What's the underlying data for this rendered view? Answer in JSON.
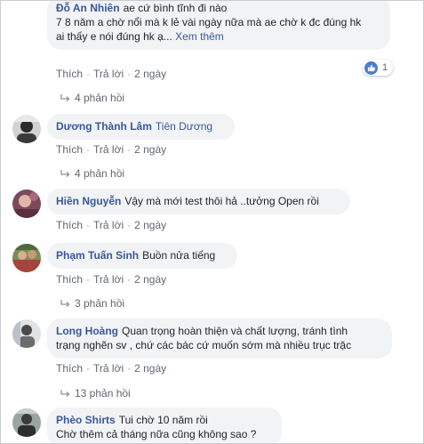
{
  "comments": [
    {
      "author": "Đỗ An Nhiên",
      "mention": "",
      "text_lines": [
        "ae cứ bình tĩnh đi nào",
        "7 8 năm a chờ nổi mà k lẻ vài ngày nữa mà ae chờ k đc đúng hk",
        "ai thấy e nói đúng hk ạ..."
      ],
      "see_more": "Xem thêm",
      "like": "Thích",
      "reply": "Trả lời",
      "time": "2 ngày",
      "reaction_count": "1",
      "reaction_icon": "like-icon",
      "replies": "4 phản hồi"
    },
    {
      "author": "Dương Thành Lâm",
      "mention": "Tiên Dương",
      "text": "",
      "like": "Thích",
      "reply": "Trả lời",
      "time": "2 ngày",
      "replies": "4 phản hồi"
    },
    {
      "author": "Hiền Nguyễn",
      "text": "Vậy mà mới test thôi hả ..tưởng Open rồi",
      "like": "Thích",
      "reply": "Trả lời",
      "time": "2 ngày"
    },
    {
      "author": "Phạm Tuấn Sinh",
      "text": "Buồn nửa tiếng",
      "like": "Thích",
      "reply": "Trả lời",
      "time": "2 ngày",
      "replies": "3 phản hồi"
    },
    {
      "author": "Long Hoàng",
      "text_lines": [
        "Quan trọng hoàn thiện và chất lượng, tránh tình",
        "trạng nghẽn sv , chứ các bác cứ muốn sớm mà nhiều trục trặc"
      ],
      "like": "Thích",
      "reply": "Trả lời",
      "time": "2 ngày",
      "replies": "13 phản hồi"
    },
    {
      "author": "Phèo Shirts",
      "text_lines": [
        "Tui chờ 10 năm rồi",
        "Chờ thêm cả tháng nữa cũng không sao ?"
      ]
    }
  ],
  "colors": {
    "link_blue": "#385898",
    "bubble_bg": "#f2f3f5",
    "meta_gray": "#606770",
    "like_blue": "#4b7bd4"
  }
}
